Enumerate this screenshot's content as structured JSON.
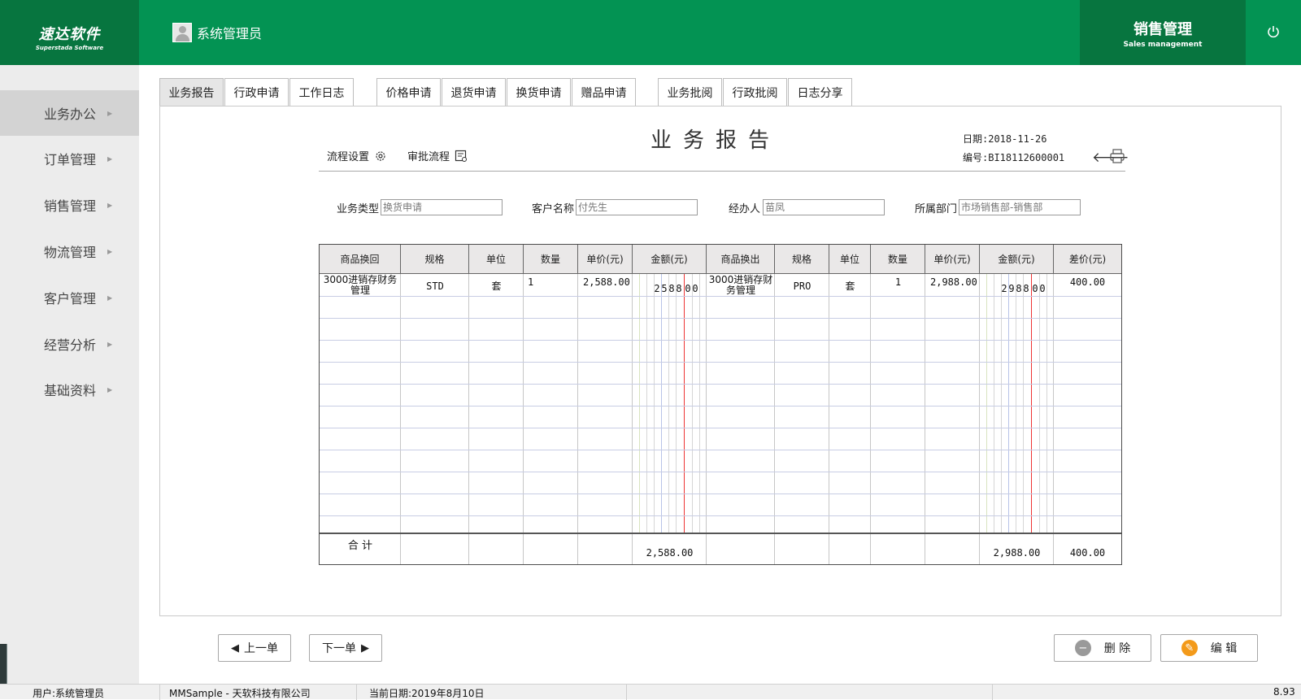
{
  "header": {
    "brand_cn": "速达软件",
    "brand_en": "Superstada Software",
    "user_name": "系统管理员",
    "module_cn": "销售管理",
    "module_en": "Sales management",
    "power_icon": "power-icon"
  },
  "sidebar": {
    "items": [
      {
        "label": "业务办公",
        "active": true
      },
      {
        "label": "订单管理"
      },
      {
        "label": "销售管理"
      },
      {
        "label": "物流管理"
      },
      {
        "label": "客户管理"
      },
      {
        "label": "经营分析"
      },
      {
        "label": "基础资料"
      }
    ]
  },
  "tabs": [
    "业务报告",
    "行政申请",
    "工作日志",
    "价格申请",
    "退货申请",
    "换货申请",
    "赠品申请",
    "业务批阅",
    "行政批阅",
    "日志分享"
  ],
  "doc": {
    "title": "业务报告",
    "flow_settings": "流程设置",
    "approval_flow": "审批流程",
    "date_label": "日期:2018-11-26",
    "number_label": "编号:BI18112600001"
  },
  "fields": {
    "type_label": "业务类型",
    "type_value": "换货申请",
    "customer_label": "客户名称",
    "customer_value": "付先生",
    "handler_label": "经办人",
    "handler_value": "苗凤",
    "dept_label": "所属部门",
    "dept_value": "市场销售部-销售部"
  },
  "table": {
    "headers": [
      "商品换回",
      "规格",
      "单位",
      "数量",
      "单价(元)",
      "金额(元)",
      "商品换出",
      "规格",
      "单位",
      "数量",
      "单价(元)",
      "金额(元)",
      "差价(元)"
    ],
    "row1": {
      "in_product": "3000进销存财务管理",
      "in_spec": "STD",
      "in_unit": "套",
      "in_qty": "1",
      "in_price": "2,588.00",
      "in_amount_digits": [
        "2",
        "5",
        "8",
        "8",
        "0",
        "0"
      ],
      "out_product": "3000进销存财务管理",
      "out_spec": "PRO",
      "out_unit": "套",
      "out_qty": "1",
      "out_price": "2,988.00",
      "out_amount_digits": [
        "2",
        "9",
        "8",
        "8",
        "0",
        "0"
      ],
      "diff": "400.00"
    },
    "total_label": "合 计",
    "total_in": "2,588.00",
    "total_out": "2,988.00",
    "total_diff": "400.00"
  },
  "buttons": {
    "prev": "上一单",
    "next": "下一单",
    "delete": "删 除",
    "edit": "编 辑"
  },
  "status": {
    "user": "用户:系统管理员",
    "company": "MMSample - 天软科技有限公司",
    "date": "当前日期:2019年8月10日",
    "version": "8.93"
  }
}
